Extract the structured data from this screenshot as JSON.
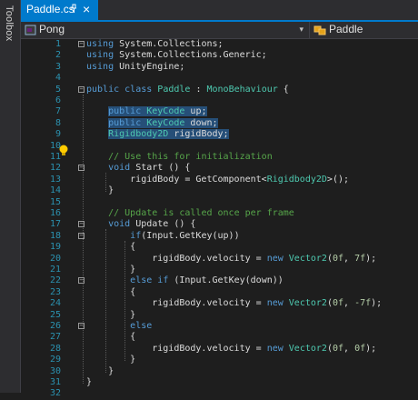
{
  "toolbox": {
    "label": "Toolbox"
  },
  "tab": {
    "filename": "Paddle.cs",
    "close": "×"
  },
  "nav": {
    "project": "Pong",
    "member": "Paddle",
    "dropdown": "▾"
  },
  "lines": [
    {
      "n": "1",
      "fold": "−",
      "code": "using System.Collections;"
    },
    {
      "n": "2",
      "fold": "",
      "code": "using System.Collections.Generic;"
    },
    {
      "n": "3",
      "fold": "",
      "code": "using UnityEngine;"
    },
    {
      "n": "4",
      "fold": "",
      "code": ""
    },
    {
      "n": "5",
      "fold": "−",
      "code": "public class Paddle : MonoBehaviour {"
    },
    {
      "n": "6",
      "fold": "",
      "code": ""
    },
    {
      "n": "7",
      "fold": "",
      "code": "    public KeyCode up;"
    },
    {
      "n": "8",
      "fold": "",
      "code": "    public KeyCode down;"
    },
    {
      "n": "9",
      "fold": "",
      "code": "    Rigidbody2D rigidBody;"
    },
    {
      "n": "10",
      "fold": "",
      "code": ""
    },
    {
      "n": "11",
      "fold": "",
      "code": "    // Use this for initialization"
    },
    {
      "n": "12",
      "fold": "−",
      "code": "    void Start () {"
    },
    {
      "n": "13",
      "fold": "",
      "code": "        rigidBody = GetComponent<Rigidbody2D>();"
    },
    {
      "n": "14",
      "fold": "",
      "code": "    }"
    },
    {
      "n": "15",
      "fold": "",
      "code": ""
    },
    {
      "n": "16",
      "fold": "",
      "code": "    // Update is called once per frame"
    },
    {
      "n": "17",
      "fold": "−",
      "code": "    void Update () {"
    },
    {
      "n": "18",
      "fold": "−",
      "code": "        if(Input.GetKey(up))"
    },
    {
      "n": "19",
      "fold": "",
      "code": "        {"
    },
    {
      "n": "20",
      "fold": "",
      "code": "            rigidBody.velocity = new Vector2(0f, 7f);"
    },
    {
      "n": "21",
      "fold": "",
      "code": "        }"
    },
    {
      "n": "22",
      "fold": "−",
      "code": "        else if (Input.GetKey(down))"
    },
    {
      "n": "23",
      "fold": "",
      "code": "        {"
    },
    {
      "n": "24",
      "fold": "",
      "code": "            rigidBody.velocity = new Vector2(0f, -7f);"
    },
    {
      "n": "25",
      "fold": "",
      "code": "        }"
    },
    {
      "n": "26",
      "fold": "−",
      "code": "        else"
    },
    {
      "n": "27",
      "fold": "",
      "code": "        {"
    },
    {
      "n": "28",
      "fold": "",
      "code": "            rigidBody.velocity = new Vector2(0f, 0f);"
    },
    {
      "n": "29",
      "fold": "",
      "code": "        }"
    },
    {
      "n": "30",
      "fold": "",
      "code": "    }"
    },
    {
      "n": "31",
      "fold": "",
      "code": "}"
    },
    {
      "n": "32",
      "fold": "",
      "code": ""
    }
  ],
  "colors": {
    "accent": "#007acc",
    "keyword": "#569cd6",
    "type": "#4ec9b0",
    "comment": "#57a64a",
    "number": "#b5cea8",
    "selection": "#264f78"
  }
}
